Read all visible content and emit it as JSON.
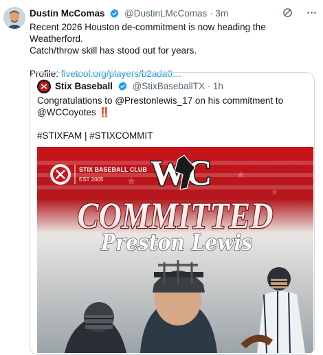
{
  "tweet": {
    "author_name": "Dustin McComas",
    "author_handle": "@DustinLMcComas",
    "separator": "·",
    "time": "3m",
    "text_line1": "Recent 2026 Houston de-commitment is now heading the Weatherford.",
    "text_line2": "Catch/throw skill has stood out for years.",
    "profile_label": "Profile: ",
    "profile_link": "fivetool.org/players/b2ada0…",
    "icons": [
      "verified-badge-icon",
      "grok-icon",
      "more-icon"
    ]
  },
  "quote": {
    "author_name": "Stix Baseball",
    "author_handle": "@StixBaseballTX",
    "separator": "·",
    "time": "1h",
    "text_line1": "Congratulations to @Prestonlewis_17 on his commitment to",
    "text_line2": "@WCCoyotes ‼️",
    "hashtags": "#STIXFAM | #STIXCOMMIT"
  },
  "graphic": {
    "club_name": "STIX BASEBALL CLUB",
    "club_est": "EST 2005",
    "school_logo_text": "WC",
    "headline": "COMMITTED",
    "player_name": "Preston Lewis",
    "colors": {
      "red": "#c8151b",
      "dark": "#1a1a1a",
      "white": "#ffffff"
    }
  },
  "colors": {
    "link": "#1d9bf0",
    "verified": "#1d9bf0",
    "muted": "#536471",
    "border": "#cfd9de"
  }
}
